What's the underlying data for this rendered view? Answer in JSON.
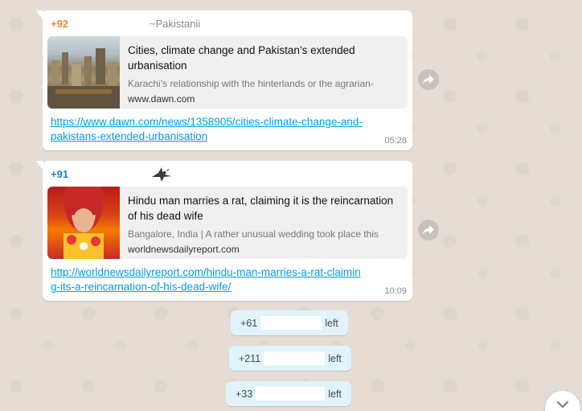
{
  "messages": [
    {
      "sender_phone": "+92",
      "sender_phone_color": "#f08a24",
      "sender_name": "~Pakistanii",
      "preview_title": "Cities, climate change and Pakistan’s extended urbanisation",
      "preview_desc": "Karachi's relationship with the hinterlands or the agrarian-",
      "preview_site": "www.dawn.com",
      "link": "https://www.dawn.com/news/1358905/cities-climate-change-and-pakistans-extended-urbanisation",
      "time": "05:28"
    },
    {
      "sender_phone": "+91",
      "sender_phone_color": "#1f7bd6",
      "preview_title": "Hindu man marries a rat, claiming it is the reincarnation of his dead wife",
      "preview_desc": "Bangalore, India | A rather unusual wedding took place this",
      "preview_site": "worldnewsdailyreport.com",
      "link": "http://worldnewsdailyreport.com/hindu-man-marries-a-rat-claiming-its-a-reincarnation-of-his-dead-wife/",
      "time": "10:09"
    }
  ],
  "system_notices": [
    {
      "phone": "+61",
      "action": "left"
    },
    {
      "phone": "+211",
      "action": "left"
    },
    {
      "phone": "+33",
      "action": "left"
    }
  ],
  "icons": {
    "forward": "forward-icon",
    "scroll_down": "chevron-down-icon",
    "sender_avatar_bird": "bird-icon"
  }
}
